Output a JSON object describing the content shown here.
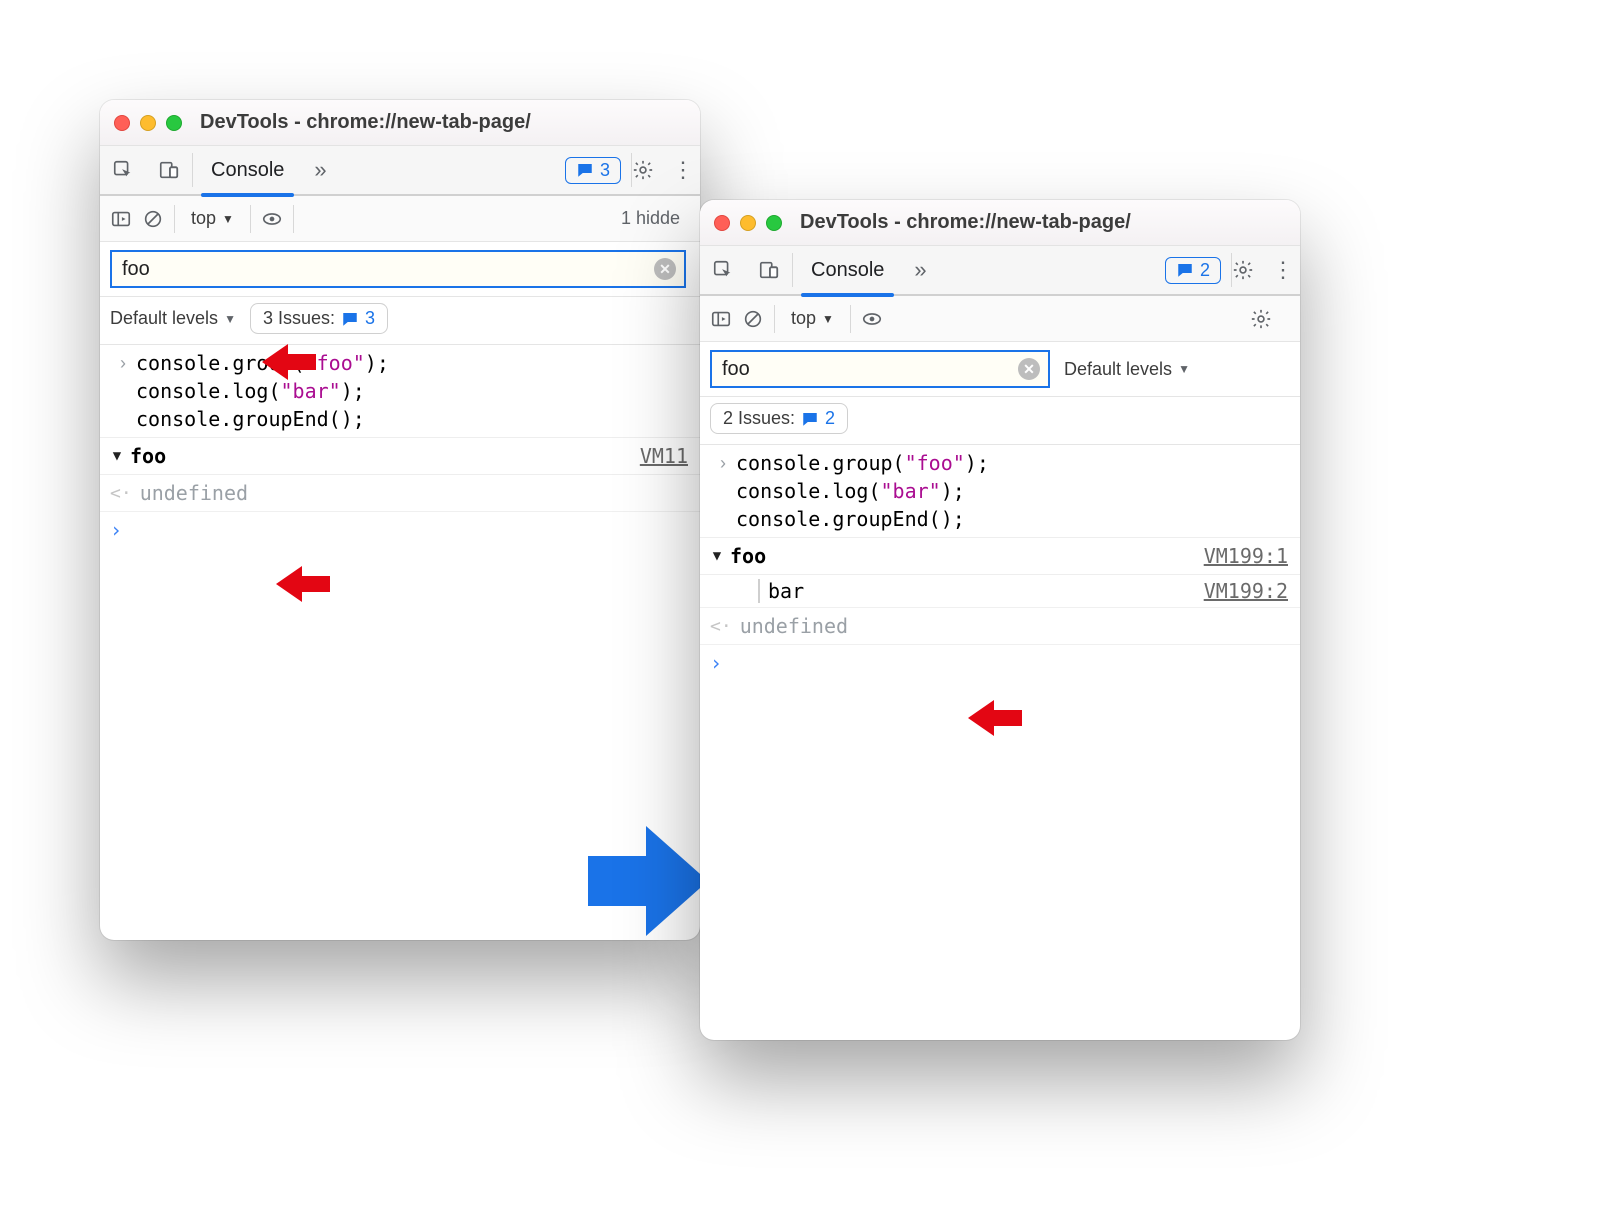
{
  "left": {
    "title": "DevTools - chrome://new-tab-page/",
    "tab": "Console",
    "messages_badge": "3",
    "context": "top",
    "hidden_text": "1 hidde",
    "filter_value": "foo",
    "levels_label": "Default levels",
    "issues_label": "3 Issues:",
    "issues_count": "3",
    "code1": "console.group(",
    "code1_str": "\"foo\"",
    "code1_end": ");",
    "code2": "console.log(",
    "code2_str": "\"bar\"",
    "code2_end": ");",
    "code3": "console.groupEnd();",
    "group_name": "foo",
    "group_src": "VM11",
    "undefined_label": "undefined"
  },
  "right": {
    "title": "DevTools - chrome://new-tab-page/",
    "tab": "Console",
    "messages_badge": "2",
    "context": "top",
    "filter_value": "foo",
    "levels_label": "Default levels",
    "issues_label": "2 Issues:",
    "issues_count": "2",
    "code1": "console.group(",
    "code1_str": "\"foo\"",
    "code1_end": ");",
    "code2": "console.log(",
    "code2_str": "\"bar\"",
    "code2_end": ");",
    "code3": "console.groupEnd();",
    "group_name": "foo",
    "group_src": "VM199:1",
    "child_label": "bar",
    "child_src": "VM199:2",
    "undefined_label": "undefined"
  }
}
